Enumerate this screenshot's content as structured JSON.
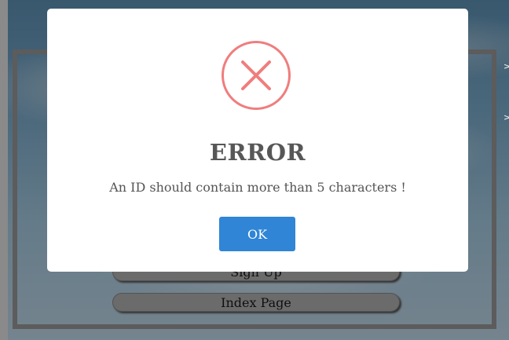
{
  "background": {
    "signup_button_label": "Sign Up",
    "index_button_label": "Index Page"
  },
  "dialog": {
    "icon": "error-x-circle-icon",
    "title": "ERROR",
    "message": "An ID should contain more than 5 characters !",
    "ok_label": "OK"
  },
  "colors": {
    "accent": "#3085d6",
    "error_icon": "#f07d7d",
    "title_text": "#575757",
    "overlay": "rgba(0,0,0,0.4)"
  }
}
